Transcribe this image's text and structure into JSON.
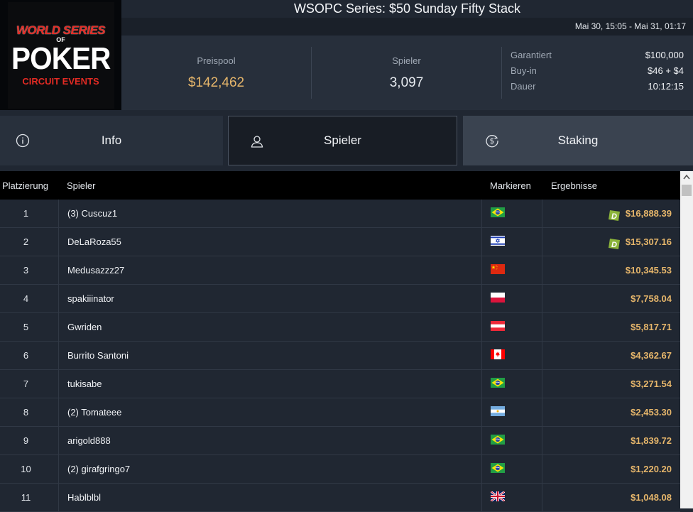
{
  "logo": {
    "line1": "WORLD SERIES",
    "line2": "OF",
    "line3": "POKER",
    "line4": "CIRCUIT EVENTS"
  },
  "title": "WSOPC Series: $50 Sunday Fifty Stack",
  "date_range": "Mai 30, 15:05 - Mai 31, 01:17",
  "stats": {
    "prizepool_label": "Preispool",
    "prizepool_value": "$142,462",
    "players_label": "Spieler",
    "players_value": "3,097"
  },
  "details": [
    {
      "key": "Garantiert",
      "value": "$100,000"
    },
    {
      "key": "Buy-in",
      "value": "$46 + $4"
    },
    {
      "key": "Dauer",
      "value": "10:12:15"
    }
  ],
  "tabs": {
    "info": "Info",
    "spieler": "Spieler",
    "staking": "Staking",
    "active": "spieler"
  },
  "table": {
    "headers": {
      "place": "Platzierung",
      "player": "Spieler",
      "mark": "Markieren",
      "results": "Ergebnisse"
    },
    "rows": [
      {
        "place": "1",
        "name": "(3) Cuscuz1",
        "flag": "brazil",
        "result": "$16,888.39",
        "deal_badge": true
      },
      {
        "place": "2",
        "name": "DeLaRoza55",
        "flag": "israel",
        "result": "$15,307.16",
        "deal_badge": true
      },
      {
        "place": "3",
        "name": "Medusazzz27",
        "flag": "china",
        "result": "$10,345.53",
        "deal_badge": false
      },
      {
        "place": "4",
        "name": "spakiiinator",
        "flag": "poland",
        "result": "$7,758.04",
        "deal_badge": false
      },
      {
        "place": "5",
        "name": "Gwriden",
        "flag": "austria",
        "result": "$5,817.71",
        "deal_badge": false
      },
      {
        "place": "6",
        "name": "Burrito Santoni",
        "flag": "canada",
        "result": "$4,362.67",
        "deal_badge": false
      },
      {
        "place": "7",
        "name": "tukisabe",
        "flag": "brazil",
        "result": "$3,271.54",
        "deal_badge": false
      },
      {
        "place": "8",
        "name": "(2) Tomateee",
        "flag": "argentina",
        "result": "$2,453.30",
        "deal_badge": false
      },
      {
        "place": "9",
        "name": "arigold888",
        "flag": "brazil",
        "result": "$1,839.72",
        "deal_badge": false
      },
      {
        "place": "10",
        "name": "(2) girafgringo7",
        "flag": "brazil",
        "result": "$1,220.20",
        "deal_badge": false
      },
      {
        "place": "11",
        "name": "Hablblbl",
        "flag": "uk",
        "result": "$1,048.08",
        "deal_badge": false
      }
    ]
  },
  "deal_badge_letter": "D",
  "colors": {
    "accent_gold": "#e6b66b",
    "deal_green": "#8bb33a",
    "background": "#202732"
  }
}
